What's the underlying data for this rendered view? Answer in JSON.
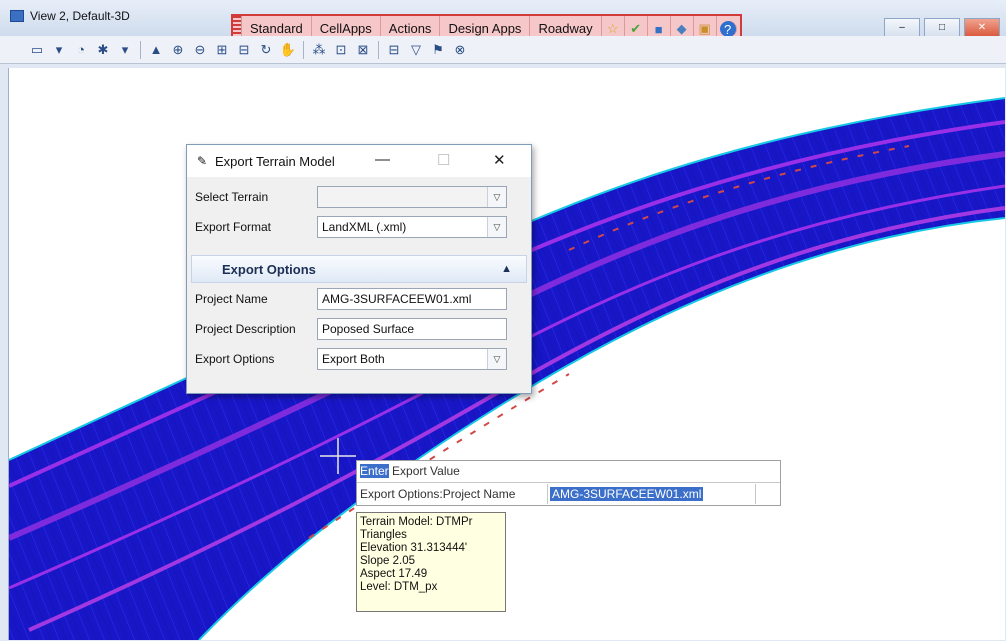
{
  "window": {
    "title": "View 2, Default-3D",
    "min": "–",
    "max": "□",
    "close": "✕"
  },
  "task_tabs": [
    "Standard",
    "CellApps",
    "Actions",
    "Design Apps",
    "Roadway"
  ],
  "task_icons": [
    "☆",
    "✔",
    "■",
    "◆",
    "▣",
    "?"
  ],
  "toolbar_icons": [
    "▭",
    "▾",
    "◔",
    "✱",
    "▾",
    "▲",
    "⊕",
    "⊖",
    "⊞",
    "⊟",
    "↻",
    "✋",
    "⁂",
    "⊡",
    "⊠",
    "⊟",
    "▽",
    "⚑",
    "⊗"
  ],
  "dialog": {
    "title": "Export Terrain Model",
    "min": "—",
    "max": "☐",
    "close": "✕",
    "select_terrain_label": "Select Terrain",
    "select_terrain_value": "",
    "export_format_label": "Export Format",
    "export_format_value": "LandXML (.xml)",
    "section_title": "Export Options",
    "project_name_label": "Project Name",
    "project_name_value": "AMG-3SURFACEEW01.xml",
    "project_desc_label": "Project Description",
    "project_desc_value": "Poposed Surface",
    "export_options_label": "Export Options",
    "export_options_value": "Export Both"
  },
  "prompt": {
    "line1_highlight": "Enter",
    "line1_rest": " Export Value",
    "line2_label": "Export Options:Project Name",
    "line2_value": "AMG-3SURFACEEW01.xml"
  },
  "tooltip": {
    "lines": [
      "Terrain Model: DTMPr",
      "Triangles",
      "Elevation 31.313444'",
      "Slope 2.05",
      "Aspect 17.49",
      "Level: DTM_px"
    ]
  },
  "colors": {
    "task_border": "#d33b3b",
    "task_bg": "#f6c7c9",
    "terrain_fill": "#1717c8",
    "terrain_lines": "#8f2fe0",
    "highlight": "#3b6fc9"
  }
}
